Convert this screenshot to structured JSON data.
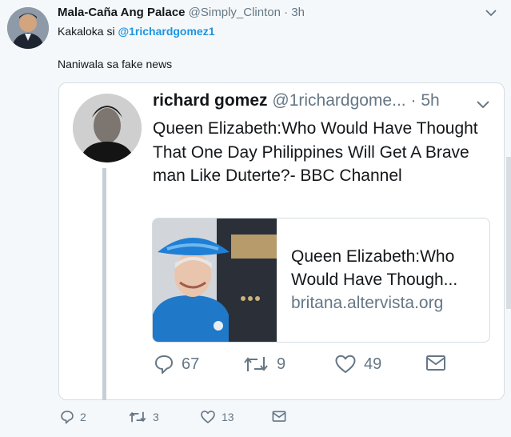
{
  "tweet": {
    "display_name": "Mala-Caña Ang Palace",
    "handle": "@Simply_Clinton",
    "separator": "·",
    "time": "3h",
    "reply_prefix": "Kakaloka si ",
    "reply_mention": "@1richardgomez1",
    "text": "Naniwala sa fake news",
    "actions": {
      "reply_count": "2",
      "retweet_count": "3",
      "like_count": "13"
    }
  },
  "quoted_tweet": {
    "display_name": "richard gomez",
    "handle": "@1richardgome...",
    "separator": "·",
    "time": "5h",
    "text": "Queen Elizabeth:Who Would Have Thought That One Day Philippines Will Get A Brave man Like Duterte?- BBC Channel",
    "link_card": {
      "title_line1": "Queen Elizabeth:Who",
      "title_line2": "Would Have Though...",
      "domain": "britana.altervista.org"
    },
    "actions": {
      "reply_count": "67",
      "retweet_count": "9",
      "like_count": "49"
    }
  },
  "colors": {
    "link": "#1b95e0",
    "secondary_text": "#657786",
    "border": "#d5dde3"
  },
  "icons": [
    "reply-icon",
    "retweet-icon",
    "like-icon",
    "message-icon",
    "chevron-down-icon"
  ]
}
